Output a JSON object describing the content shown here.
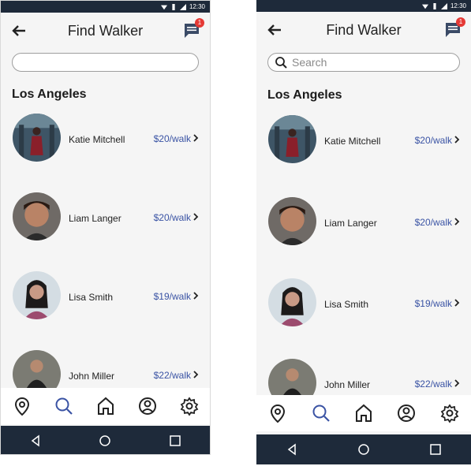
{
  "status": {
    "time": "12:30"
  },
  "header": {
    "title": "Find Walker",
    "notification_count": "1"
  },
  "search": {
    "placeholder": "Search"
  },
  "section": {
    "title": "Los Angeles"
  },
  "walkers": [
    {
      "name": "Katie Mitchell",
      "price": "$20/walk"
    },
    {
      "name": "Liam Langer",
      "price": "$20/walk"
    },
    {
      "name": "Lisa Smith",
      "price": "$19/walk"
    },
    {
      "name": "John Miller",
      "price": "$22/walk"
    }
  ],
  "colors": {
    "accent": "#3a53a4",
    "statusbar": "#1e2a3a",
    "badge": "#e53935"
  },
  "icons": {
    "nav": [
      "location-pin-icon",
      "search-icon",
      "home-icon",
      "profile-icon",
      "settings-gear-icon"
    ],
    "system": [
      "back-triangle-icon",
      "home-circle-icon",
      "recents-square-icon"
    ]
  }
}
